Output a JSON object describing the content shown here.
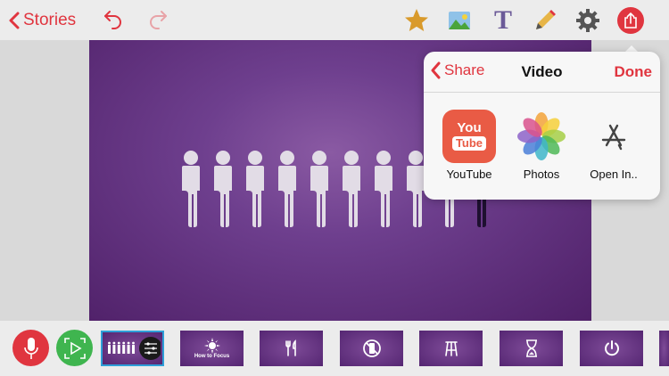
{
  "toolbar": {
    "back_label": "Stories",
    "icons": [
      "undo-icon",
      "redo-icon",
      "star-icon",
      "image-icon",
      "text-icon",
      "pencil-icon",
      "gear-icon",
      "share-icon"
    ]
  },
  "share_popover": {
    "back_label": "Share",
    "title": "Video",
    "done_label": "Done",
    "items": [
      {
        "label": "YouTube",
        "icon": "youtube-icon",
        "logo_top": "You",
        "logo_bottom": "Tube"
      },
      {
        "label": "Photos",
        "icon": "photos-icon"
      },
      {
        "label": "Open In..",
        "icon": "app-store-icon"
      }
    ]
  },
  "slide": {
    "people_count": 10,
    "highlighted_person": 10
  },
  "timeline": {
    "buttons": [
      "microphone-icon",
      "play-icon"
    ],
    "thumbnails": [
      {
        "icon": "people-sliders-icon",
        "selected": true
      },
      {
        "icon": "sunburst-icon",
        "caption": "How to Focus"
      },
      {
        "icon": "fork-knife-icon"
      },
      {
        "icon": "no-phone-icon"
      },
      {
        "icon": "stool-icon"
      },
      {
        "icon": "hourglass-icon"
      },
      {
        "icon": "power-icon"
      }
    ]
  },
  "colors": {
    "accent": "#e0353f",
    "slide_purple": "#6e3f8e",
    "record_red": "#e0353f",
    "play_green": "#3fb54f",
    "star": "#d99a2b"
  }
}
